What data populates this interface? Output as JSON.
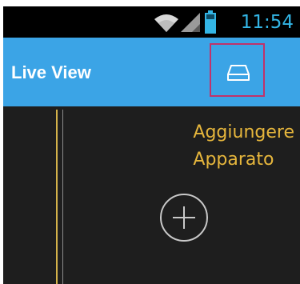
{
  "status_bar": {
    "time": "11:54",
    "icons": [
      "wifi-icon",
      "cell-signal-icon",
      "battery-icon"
    ]
  },
  "app_bar": {
    "title": "Live View",
    "action_icon": "storage-device-icon"
  },
  "add_device": {
    "label_line1": "Aggiungere",
    "label_line2": "Apparato",
    "icon": "plus-circle-icon"
  },
  "colors": {
    "status_accent": "#33b5e5",
    "app_bar": "#3ba4e6",
    "highlight_border": "#c1336b",
    "label_yellow": "#e6b63c",
    "background": "#1e1e1e"
  }
}
